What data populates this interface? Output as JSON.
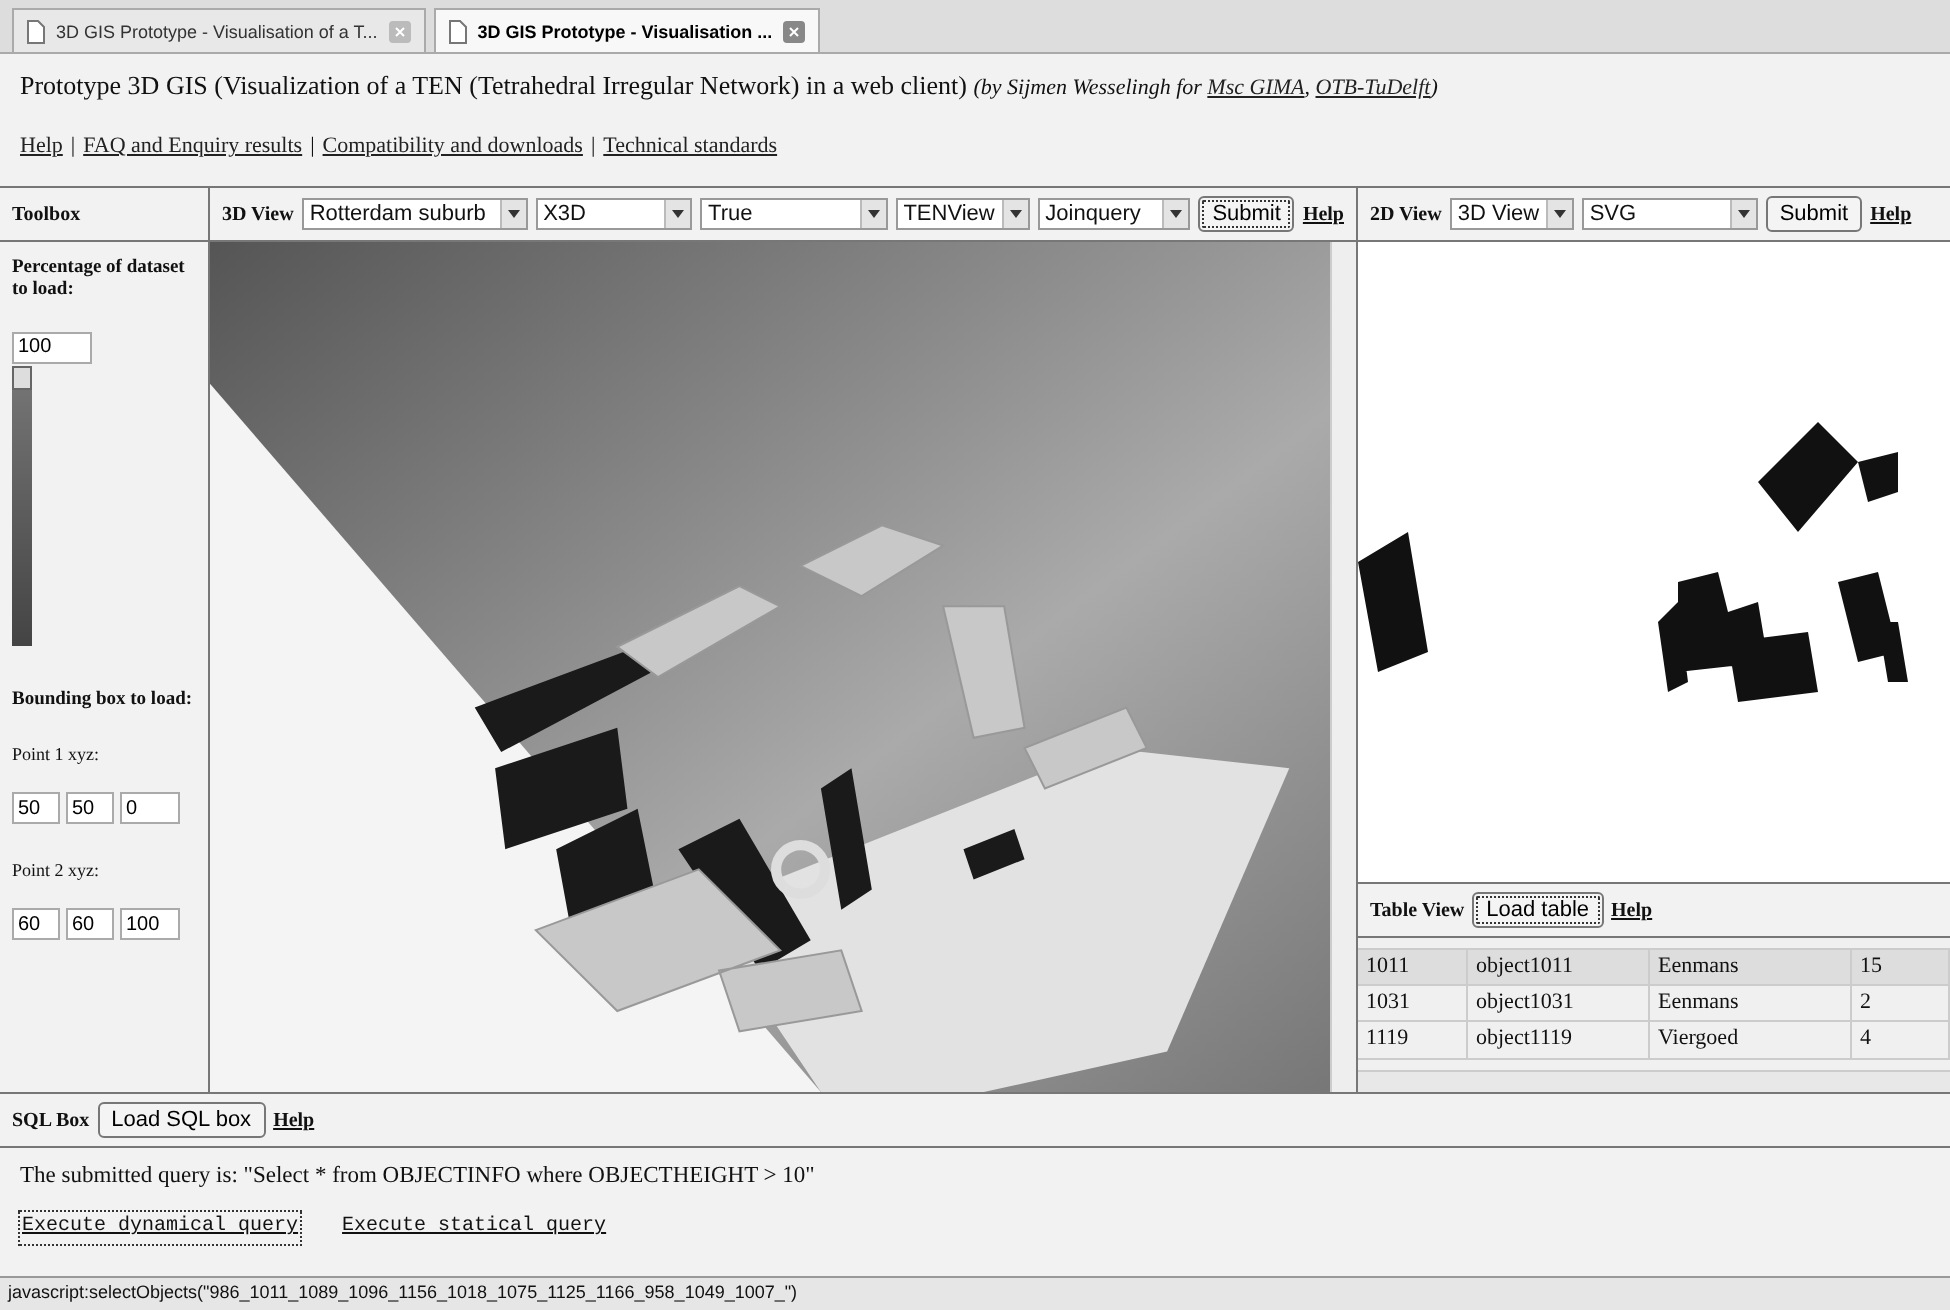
{
  "browser_tabs": [
    {
      "label": "3D GIS Prototype - Visualisation of a T...",
      "selected": false
    },
    {
      "label": "3D GIS Prototype - Visualisation ...",
      "selected": true
    }
  ],
  "heading": {
    "title": "Prototype 3D GIS (Visualization of a TEN (Tetrahedral Irregular Network) in a web client)",
    "byline_prefix": "(by Sijmen Wesselingh for ",
    "byline_links": [
      "Msc GIMA",
      "OTB-TuDelft"
    ],
    "byline_separator": ",",
    "byline_suffix": ")"
  },
  "nav_separator": "|",
  "nav_links": [
    "Help",
    "FAQ and Enquiry results",
    "Compatibility and downloads",
    "Technical standards"
  ],
  "toolbox": {
    "title": "Toolbox",
    "percentage_label": "Percentage of dataset to load:",
    "percentage_value": "100",
    "slider": {
      "level": 1
    },
    "bbox_label": "Bounding box to load:",
    "point1_label": "Point 1 xyz:",
    "point1": [
      "50",
      "50",
      "0"
    ],
    "point2_label": "Point 2 xyz:",
    "point2": [
      "60",
      "60",
      "100"
    ]
  },
  "view3d": {
    "title": "3D View",
    "selects": [
      "Rotterdam suburb",
      "X3D",
      "True",
      "TENView",
      "Joinquery"
    ],
    "submit": "Submit",
    "help": "Help"
  },
  "view2d": {
    "title": "2D View",
    "selects": [
      "3D View",
      "SVG"
    ],
    "submit": "Submit",
    "help": "Help"
  },
  "table_view": {
    "title": "Table View",
    "button": "Load table",
    "help": "Help",
    "rows": [
      {
        "cells": [
          "1011",
          "object1011",
          "Eenmans",
          "15"
        ],
        "selected": true
      },
      {
        "cells": [
          "1031",
          "object1031",
          "Eenmans",
          "2"
        ],
        "selected": false
      },
      {
        "cells": [
          "1119",
          "object1119",
          "Viergoed",
          "4"
        ],
        "selected": false
      }
    ]
  },
  "sql_box": {
    "title": "SQL Box",
    "button": "Load SQL box",
    "help": "Help",
    "query_text": "The submitted query is: \"Select * from OBJECTINFO where OBJECTHEIGHT > 10\"",
    "actions": [
      "Execute dynamical query",
      "Execute statical query"
    ]
  },
  "status_bar": "javascript:selectObjects(\"986_1011_1089_1096_1156_1018_1075_1125_1166_958_1049_1007_\")"
}
